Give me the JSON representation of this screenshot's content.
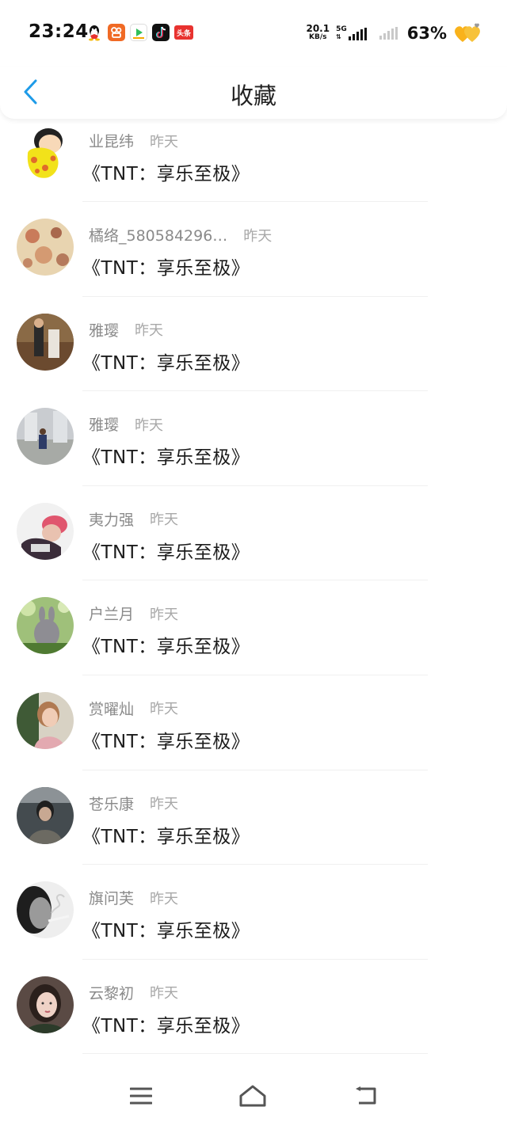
{
  "status_bar": {
    "time": "23:24",
    "net_speed_value": "20.1",
    "net_speed_unit": "KB/s",
    "network_type": "5G",
    "battery": "63%",
    "icons": [
      "qq-icon",
      "kuaishou-icon",
      "ixigua-icon",
      "douyin-icon",
      "toutiao-icon"
    ],
    "toutiao_label": "头条"
  },
  "header": {
    "title": "收藏",
    "back_icon": "chevron-left-icon",
    "accent_color": "#1e9be8"
  },
  "favorites": [
    {
      "user": "业昆纬",
      "time": "昨天",
      "title": "《TNT：享乐至极》",
      "avatar": "cartoon-avatar"
    },
    {
      "user": "橘络_580584296…",
      "time": "昨天",
      "title": "《TNT：享乐至极》",
      "avatar": "pattern-avatar"
    },
    {
      "user": "雅璎",
      "time": "昨天",
      "title": "《TNT：享乐至极》",
      "avatar": "photo-avatar"
    },
    {
      "user": "雅璎",
      "time": "昨天",
      "title": "《TNT：享乐至极》",
      "avatar": "photo-avatar"
    },
    {
      "user": "夷力强",
      "time": "昨天",
      "title": "《TNT：享乐至极》",
      "avatar": "photo-avatar"
    },
    {
      "user": "户兰月",
      "time": "昨天",
      "title": "《TNT：享乐至极》",
      "avatar": "photo-avatar"
    },
    {
      "user": "赏曜灿",
      "time": "昨天",
      "title": "《TNT：享乐至极》",
      "avatar": "photo-avatar"
    },
    {
      "user": "苍乐康",
      "time": "昨天",
      "title": "《TNT：享乐至极》",
      "avatar": "photo-avatar"
    },
    {
      "user": "旗问芙",
      "time": "昨天",
      "title": "《TNT：享乐至极》",
      "avatar": "photo-avatar"
    },
    {
      "user": "云黎初",
      "time": "昨天",
      "title": "《TNT：享乐至极》",
      "avatar": "photo-avatar"
    }
  ],
  "nav": {
    "icons": [
      "menu-icon",
      "home-icon",
      "back-icon"
    ]
  }
}
